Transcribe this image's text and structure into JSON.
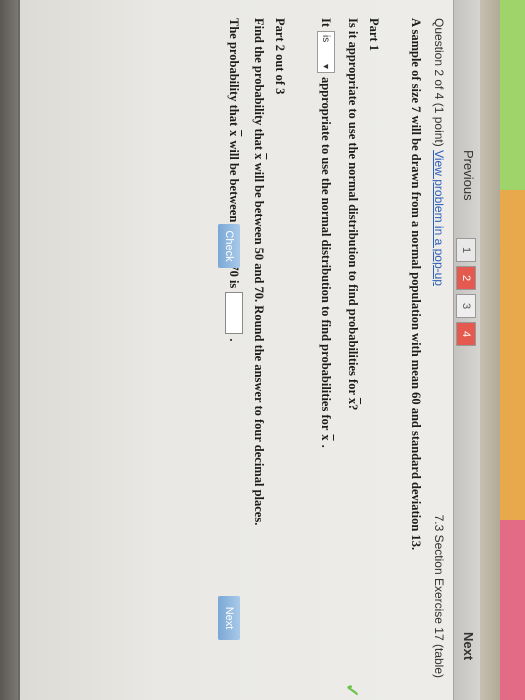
{
  "nav": {
    "previous_label": "Previous",
    "next_label": "Next",
    "tabs": [
      "1",
      "2",
      "3",
      "4"
    ]
  },
  "question": {
    "title": "Question 2 of 4 (1 point)",
    "popup_link": "View problem in a pop-up",
    "section": "7.3 Section Exercise 17 (table)",
    "problem": "A sample of size 7 will be drawn from a normal population with mean 60 and standard deviation 13."
  },
  "part1": {
    "title": "Part 1",
    "question_pre": "Is it appropriate to use the normal distribution to find probabilities for",
    "question_var": "x",
    "question_post": "?",
    "answer_pre": "It",
    "select_value": "is",
    "answer_post": "appropriate to use the normal distribution to find probabilities for",
    "answer_var": "x",
    "answer_end": "."
  },
  "part2": {
    "title": "Part 2 out of 3",
    "question_pre": "Find the probability that",
    "question_var": "x",
    "question_post": "will be between 50 and 70. Round the answer to four decimal places.",
    "prob_pre": "The probability that",
    "prob_var": "x",
    "prob_post": "will be between 50 and 70 is",
    "prob_end": "."
  },
  "buttons": {
    "check": "Check",
    "next": "Next"
  },
  "colors": {
    "tab_active": "#e55a4f",
    "link": "#2d5fb8",
    "check_ok": "#6cc24a",
    "button": "#7aa8d6"
  },
  "icons": {
    "correct": "check-mark-icon",
    "dropdown": "caret-down-icon"
  }
}
